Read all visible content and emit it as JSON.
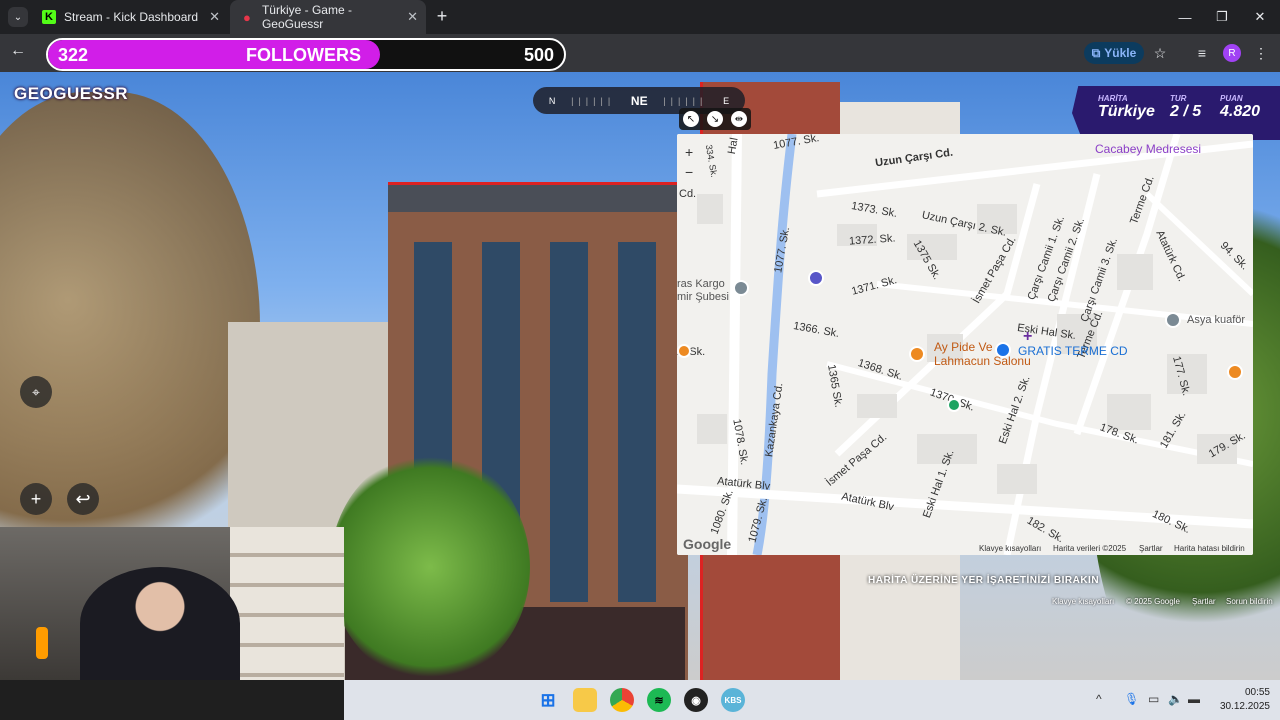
{
  "browser": {
    "tabs": [
      {
        "title": "Stream - Kick Dashboard",
        "icon": "kick-logo-icon"
      },
      {
        "title": "Türkiye - Game - GeoGuessr",
        "icon": "location-pin-icon"
      }
    ],
    "new_tab": "+",
    "window_controls": {
      "minimize": "—",
      "maximize": "❐",
      "close": "✕"
    },
    "back": "←",
    "upload_button": "Yükle",
    "profile_initial": "R"
  },
  "followers_goal": {
    "current": "322",
    "label": "FOLLOWERS",
    "goal": "500",
    "progress": 0.644
  },
  "game": {
    "logo": "GEOGUESSR",
    "compass": {
      "left": "N",
      "center": "NE",
      "right": "E"
    },
    "hud": {
      "map_caption": "HARİTA",
      "map_value": "Türkiye",
      "round_caption": "TUR",
      "round_value": "2 / 5",
      "score_caption": "PUAN",
      "score_value": "4.820"
    },
    "hint": "HARİTA ÜZERİNE YER İŞARETİNİZİ BIRAKIN",
    "bottom_links": [
      "Klavye kısayolları",
      "© 2025 Google",
      "Şartlar",
      "Sorun bildirin"
    ]
  },
  "map": {
    "zoom_in": "+",
    "zoom_out": "−",
    "labels": {
      "uzun_carsi_cd": "Uzun Çarşı Cd.",
      "sk1077_top": "1077. Sk.",
      "hal": "Hal",
      "cacabey": "Cacabey Medresesi",
      "sk1373": "1373. Sk.",
      "uzun_carsi_2": "Uzun Çarşı 2. Sk.",
      "sk1372": "1372. Sk.",
      "sk1375": "1375 Sk.",
      "ismet_pasa_cd_top": "İsmet Paşa Cd.",
      "carsi_camii_1": "Çarşı Camii 1. Sk.",
      "carsi_camii_2": "Çarşı Camii 2. Sk.",
      "carsi_camii_3": "Çarşı Camii 3. Sk.",
      "terme_cd_top": "Terme Cd.",
      "ataturk_cd": "Atatürk Cd.",
      "sk94": "94. Sk.",
      "kargo": "ras Kargo\nmir Şubesi",
      "sk1077": "1077. Sk.",
      "sk1371": "1371. Sk.",
      "sk1366": "1366. Sk.",
      "eski_hal_sk": "Eski Hal Sk.",
      "terme_cd": "Terme Cd.",
      "asya": "Asya kuaför",
      "sk2": "2. Sk.",
      "ay_pide": "Ay Pide Ve\nLahmacun Salonu",
      "sk1368": "1368. Sk.",
      "sk1365": "1365 Sk.",
      "sk1370": "1370. Sk.",
      "sk177": "177. Sk.",
      "eski_hal_2": "Eski Hal 2. Sk.",
      "kazankaya": "Kazankaya Cd.",
      "sk1078": "1078. Sk.",
      "sk178": "178. Sk.",
      "sk181": "181. Sk.",
      "sk179": "179. Sk.",
      "ismet_pasa_cd": "İsmet Paşa Cd.",
      "gratis": "GRATIS TERME CD",
      "ataturk_blv_left": "Atatürk Blv",
      "eski_hal_1": "Eski Hal 1. Sk.",
      "ataturk_blv": "Atatürk Blv",
      "sk1080": "1080. Sk.",
      "sk1079": "1079. Sk.",
      "sk182": "182. Sk.",
      "sk180": "180. Sk.",
      "cd_left": "Cd.",
      "sk334": "334. Sk."
    },
    "footer": [
      "Klavye kısayolları",
      "Harita verileri ©2025",
      "Şartlar",
      "Harita hatası bildirin"
    ],
    "google": "Google"
  },
  "taskbar": {
    "apps": [
      "windows-start-icon",
      "file-explorer-icon",
      "chrome-icon",
      "spotify-icon",
      "obs-icon",
      "kbs-icon"
    ],
    "kbs_label": "KBS",
    "time": "00:55",
    "date": "30.12.2025"
  }
}
